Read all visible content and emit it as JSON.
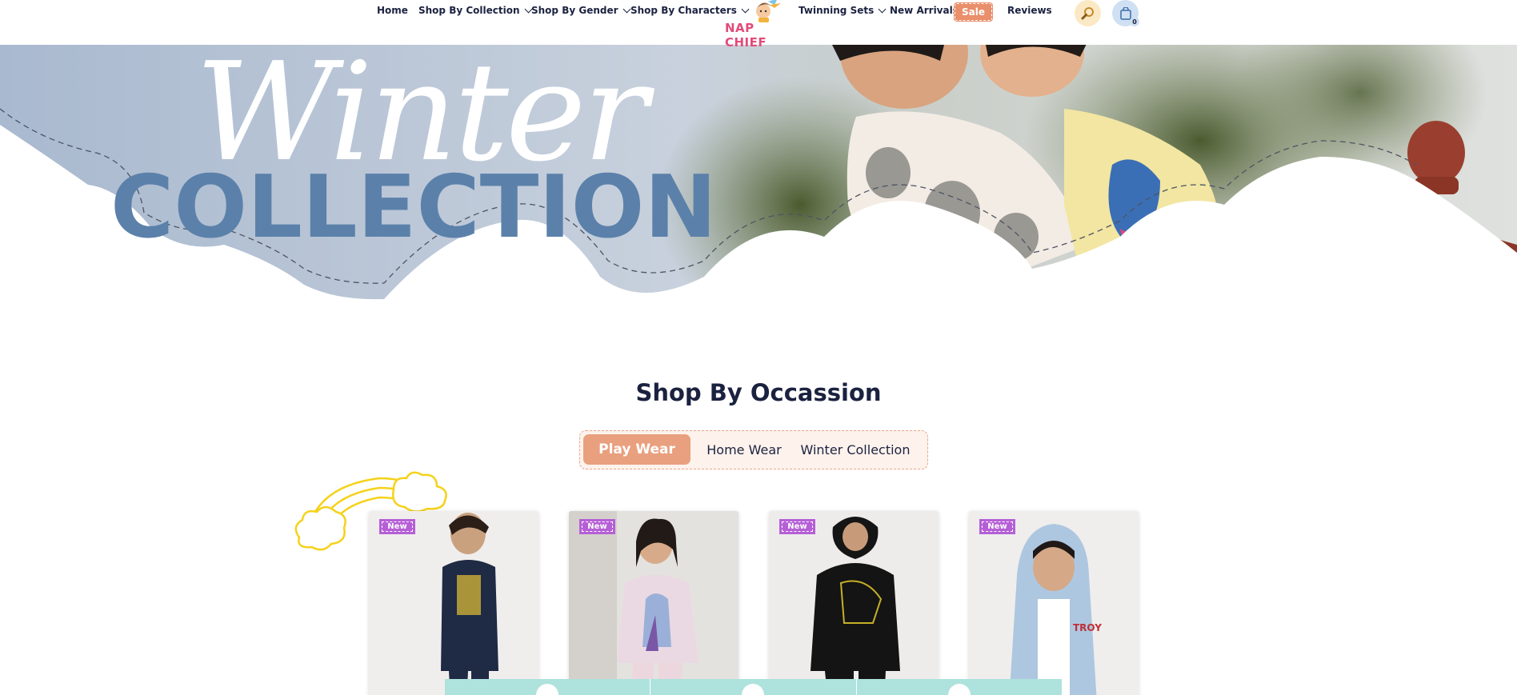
{
  "nav": {
    "items": [
      {
        "label": "Home",
        "dropdown": false
      },
      {
        "label": "Shop By Collection",
        "dropdown": true
      },
      {
        "label": "Shop By Gender",
        "dropdown": true
      },
      {
        "label": "Shop By Characters",
        "dropdown": true
      },
      {
        "label": "Twinning Sets",
        "dropdown": true
      },
      {
        "label": "New Arrivals",
        "dropdown": false
      },
      {
        "label": "Sale",
        "dropdown": false
      },
      {
        "label": "Reviews",
        "dropdown": false
      }
    ],
    "logo_text": "NAP CHIEF",
    "search_icon": "magnifier-icon",
    "cart_icon": "shopping-bag-icon",
    "cart_count": "0"
  },
  "hero": {
    "script_text": "Winter",
    "block_text": "COLLECTION"
  },
  "occasion": {
    "title": "Shop By Occassion",
    "tabs": [
      {
        "label": "Play Wear",
        "active": true
      },
      {
        "label": "Home Wear",
        "active": false
      },
      {
        "label": "Winter Collection",
        "active": false
      }
    ]
  },
  "products": [
    {
      "badge": "New"
    },
    {
      "badge": "New"
    },
    {
      "badge": "New"
    },
    {
      "badge": "New"
    }
  ],
  "colors": {
    "accent_peach": "#e9a07f",
    "badge_purple": "#b55fd6",
    "navy_text": "#1b2240",
    "hero_blue": "#5b81aa",
    "bar_mint": "#aee2dc"
  }
}
